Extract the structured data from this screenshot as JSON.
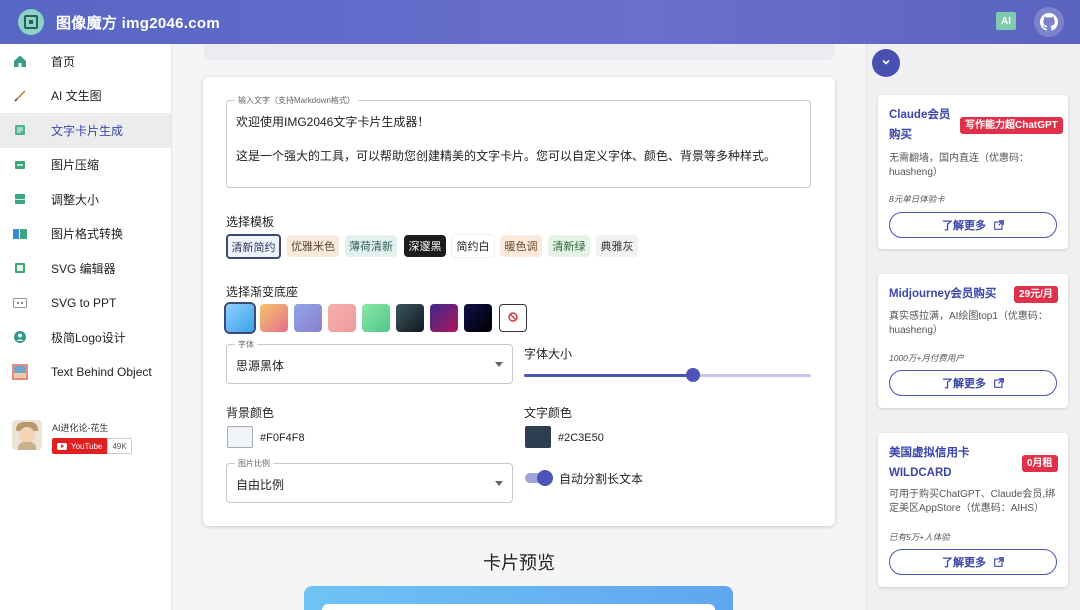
{
  "header": {
    "site_title": "图像魔方 img2046.com",
    "ai_badge": "AI",
    "logo_icon": "crop-frame-icon",
    "github_icon": "github-icon"
  },
  "sidebar": {
    "items": [
      {
        "label": "首页",
        "icon": "home-icon"
      },
      {
        "label": "AI 文生图",
        "icon": "pencil-icon"
      },
      {
        "label": "文字卡片生成",
        "icon": "text-card-icon",
        "active": true
      },
      {
        "label": "图片压缩",
        "icon": "compress-icon"
      },
      {
        "label": "调整大小",
        "icon": "resize-icon"
      },
      {
        "label": "图片格式转换",
        "icon": "format-convert-icon"
      },
      {
        "label": "SVG 编辑器",
        "icon": "svg-editor-icon"
      },
      {
        "label": "SVG to PPT",
        "icon": "ppt-icon"
      },
      {
        "label": "极简Logo设计",
        "icon": "logo-design-icon"
      },
      {
        "label": "Text Behind Object",
        "icon": "image-layer-icon"
      }
    ],
    "author": {
      "name": "AI进化论-花生",
      "youtube_label": "YouTube",
      "subscriber_count": "49K"
    }
  },
  "editor": {
    "text_input": {
      "label": "输入文字（支持Markdown格式）",
      "line1": "欢迎使用IMG2046文字卡片生成器！",
      "line2": "这是一个强大的工具，可以帮助您创建精美的文字卡片。您可以自定义字体、颜色、背景等多种样式。"
    },
    "template_label": "选择模板",
    "templates": [
      "清新简约",
      "优雅米色",
      "薄荷清新",
      "深邃黑",
      "简约白",
      "暖色调",
      "清新绿",
      "典雅灰"
    ],
    "selected_template": "清新简约",
    "gradient_label": "选择渐变底座",
    "font": {
      "label": "字体",
      "value": "思源黑体"
    },
    "font_size": {
      "label": "字体大小",
      "level_percent": 59
    },
    "bg_color": {
      "label": "背景颜色",
      "value": "#F0F4F8"
    },
    "text_color": {
      "label": "文字颜色",
      "value": "#2C3E50"
    },
    "ratio": {
      "label": "图片比例",
      "value": "自由比例"
    },
    "auto_split": {
      "label": "自动分割长文本",
      "enabled": true
    }
  },
  "preview": {
    "title": "卡片预览"
  },
  "ads": [
    {
      "title": "Claude会员购买",
      "badge": "写作能力超ChatGPT",
      "desc": "无需翻墙，国内直连（优惠码：huasheng）",
      "meta": "8元单日体验卡",
      "button": "了解更多"
    },
    {
      "title": "Midjourney会员购买",
      "badge": "29元/月",
      "desc": "真实感拉满，AI绘图top1（优惠码：huasheng）",
      "meta": "1000万+月付费用户",
      "button": "了解更多"
    },
    {
      "title": "美国虚拟信用卡WILDCARD",
      "badge": "0月租",
      "desc": "可用于购买ChatGPT、Claude会员,绑定美区AppStore（优惠码：AIHS）",
      "meta": "已有5万+人体验",
      "button": "了解更多"
    }
  ],
  "colors": {
    "accent": "#4A55B5",
    "header": "#5E68C6",
    "badge_red": "#E0304A"
  }
}
